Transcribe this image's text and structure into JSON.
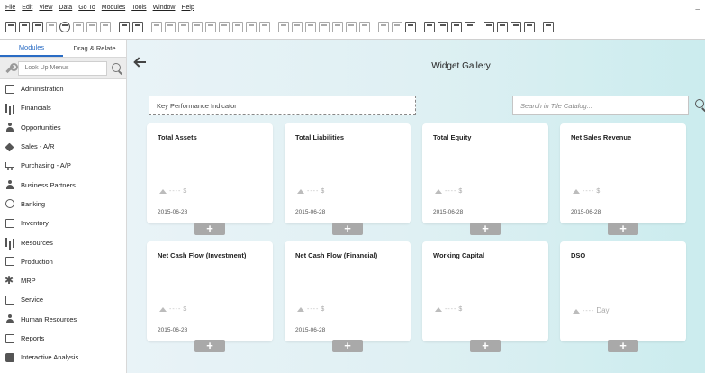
{
  "menu": [
    "File",
    "Edit",
    "View",
    "Data",
    "Go To",
    "Modules",
    "Tools",
    "Window",
    "Help"
  ],
  "window_minimize": "_",
  "sidebar": {
    "tabs": [
      "Modules",
      "Drag & Relate"
    ],
    "search_placeholder": "Look Up Menus",
    "items": [
      {
        "label": "Administration",
        "icon": "administration-icon"
      },
      {
        "label": "Financials",
        "icon": "financials-icon"
      },
      {
        "label": "Opportunities",
        "icon": "opportunities-icon"
      },
      {
        "label": "Sales - A/R",
        "icon": "sales-icon"
      },
      {
        "label": "Purchasing - A/P",
        "icon": "purchasing-icon"
      },
      {
        "label": "Business Partners",
        "icon": "business-partners-icon"
      },
      {
        "label": "Banking",
        "icon": "banking-icon"
      },
      {
        "label": "Inventory",
        "icon": "inventory-icon"
      },
      {
        "label": "Resources",
        "icon": "resources-icon"
      },
      {
        "label": "Production",
        "icon": "production-icon"
      },
      {
        "label": "MRP",
        "icon": "mrp-icon"
      },
      {
        "label": "Service",
        "icon": "service-icon"
      },
      {
        "label": "Human Resources",
        "icon": "human-resources-icon"
      },
      {
        "label": "Reports",
        "icon": "reports-icon"
      },
      {
        "label": "Interactive Analysis",
        "icon": "interactive-analysis-icon"
      }
    ]
  },
  "main": {
    "title": "Widget Gallery",
    "category_field": "Key Performance Indicator",
    "tile_search_placeholder": "Search in Tile Catalog...",
    "add_label": "+",
    "tiles": [
      {
        "title": "Total Assets",
        "unit": "$",
        "date": "2015-06-28"
      },
      {
        "title": "Total Liabilities",
        "unit": "$",
        "date": "2015-06-28"
      },
      {
        "title": "Total Equity",
        "unit": "$",
        "date": "2015-06-28"
      },
      {
        "title": "Net Sales Revenue",
        "unit": "$",
        "date": "2015-06-28"
      },
      {
        "title": "Net Cash Flow (Investment)",
        "unit": "$",
        "date": "2015-06-28"
      },
      {
        "title": "Net Cash Flow (Financial)",
        "unit": "$",
        "date": "2015-06-28"
      },
      {
        "title": "Working Capital",
        "unit": "$",
        "date": ""
      },
      {
        "title": "DSO",
        "unit": "Day",
        "date": ""
      }
    ],
    "trend_placeholder": "----"
  },
  "colors": {
    "accent": "#2a6cc4",
    "add_button": "#a9a9a9"
  }
}
